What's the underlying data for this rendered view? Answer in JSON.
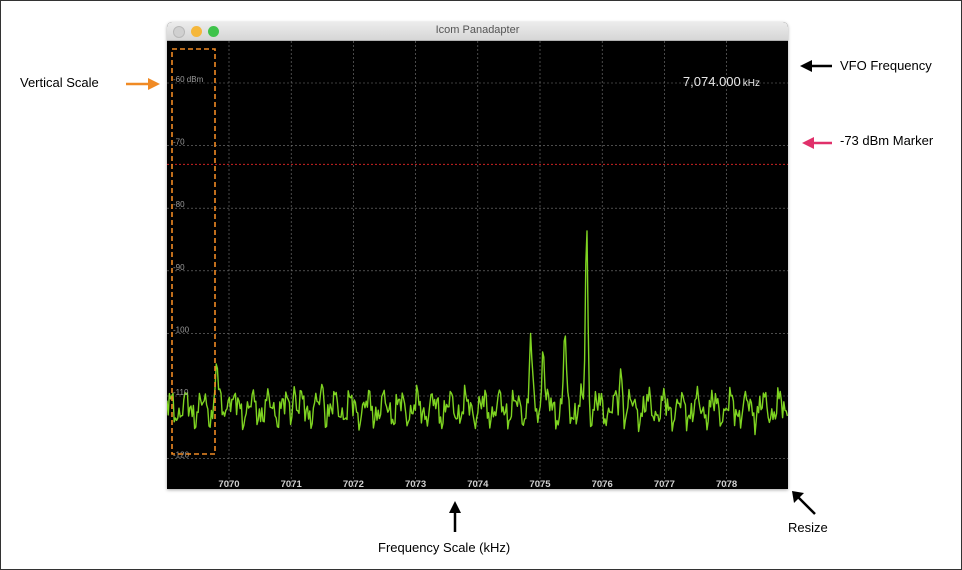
{
  "window": {
    "title": "Icom Panadapter"
  },
  "vfo": {
    "value": "7,074.000",
    "unit": "kHz"
  },
  "vertical_scale": {
    "labels": [
      "-60 dBm",
      "-70",
      "-80",
      "-90",
      "-100",
      "-110",
      "-120"
    ],
    "values": [
      -60,
      -70,
      -80,
      -90,
      -100,
      -110,
      -120
    ]
  },
  "frequency_scale": {
    "labels": [
      "7070",
      "7071",
      "7072",
      "7073",
      "7074",
      "7075",
      "7076",
      "7077",
      "7078"
    ],
    "values": [
      7070,
      7071,
      7072,
      7073,
      7074,
      7075,
      7076,
      7077,
      7078
    ]
  },
  "marker": {
    "level_dbm": -73,
    "color": "#cc2222"
  },
  "colors": {
    "trace": "#7ed321",
    "grid": "#7a7a7a",
    "scale_box": "#f08a24",
    "marker_arrow": "#e0306a",
    "black_arrow": "#000000"
  },
  "chart_data": {
    "type": "line",
    "title": "",
    "xlabel": "",
    "ylabel": "",
    "xlim": [
      7069.2,
      7079.0
    ],
    "ylim": [
      -120.0,
      -57.0
    ],
    "grid": true,
    "baseline_dbm": -112,
    "peaks": [
      {
        "x": 7069.8,
        "y": -104.5
      },
      {
        "x": 7070.0,
        "y": -110
      },
      {
        "x": 7071.05,
        "y": -108.5
      },
      {
        "x": 7071.5,
        "y": -108
      },
      {
        "x": 7074.85,
        "y": -100
      },
      {
        "x": 7075.05,
        "y": -102
      },
      {
        "x": 7075.4,
        "y": -99.5
      },
      {
        "x": 7075.75,
        "y": -82.5
      },
      {
        "x": 7076.3,
        "y": -105.5
      }
    ]
  },
  "annotations": {
    "vertical_scale": "Vertical Scale",
    "vfo_frequency": "VFO Frequency",
    "marker": "-73 dBm Marker",
    "frequency_scale": "Frequency Scale (kHz)",
    "resize": "Resize"
  }
}
